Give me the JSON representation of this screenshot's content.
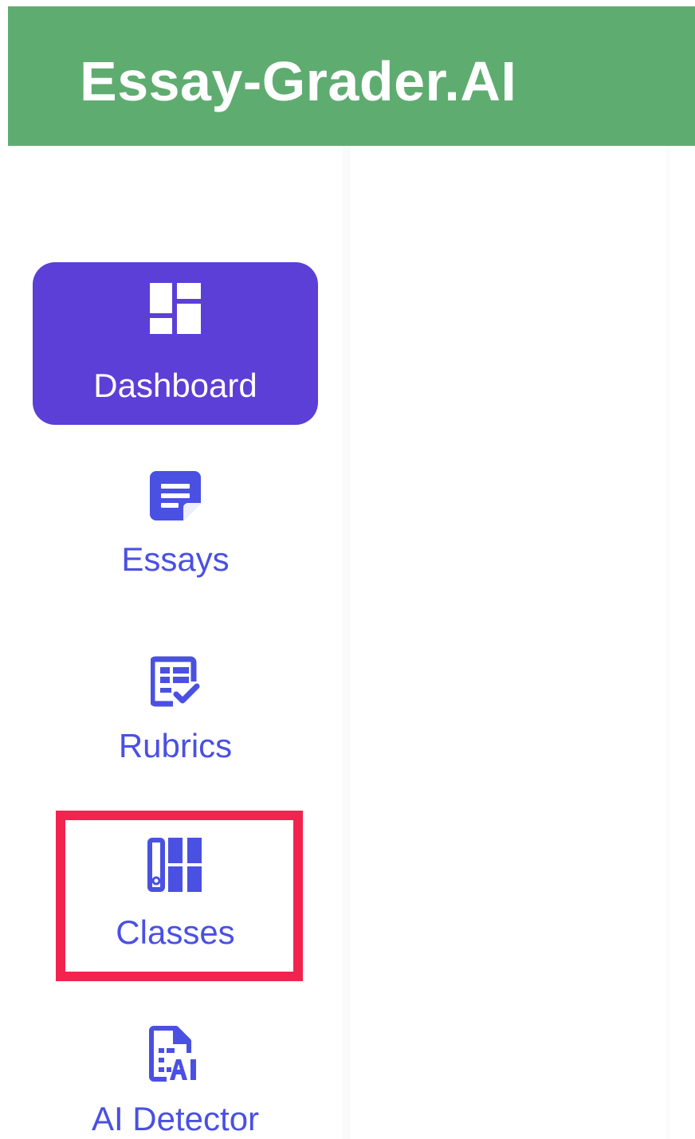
{
  "header": {
    "title": "Essay-Grader.AI",
    "background_color": "#5fac71"
  },
  "sidebar": {
    "items": [
      {
        "label": "Dashboard",
        "icon": "dashboard-icon",
        "active": true
      },
      {
        "label": "Essays",
        "icon": "essay-document-icon",
        "active": false
      },
      {
        "label": "Rubrics",
        "icon": "rubric-checklist-icon",
        "active": false
      },
      {
        "label": "Classes",
        "icon": "classes-binder-icon",
        "active": false,
        "highlighted": true
      },
      {
        "label": "AI Detector",
        "icon": "ai-detector-document-icon",
        "active": false
      }
    ],
    "active_color": "#5b3fd6",
    "text_color": "#4a50e2",
    "highlight_color": "#f2234f"
  }
}
